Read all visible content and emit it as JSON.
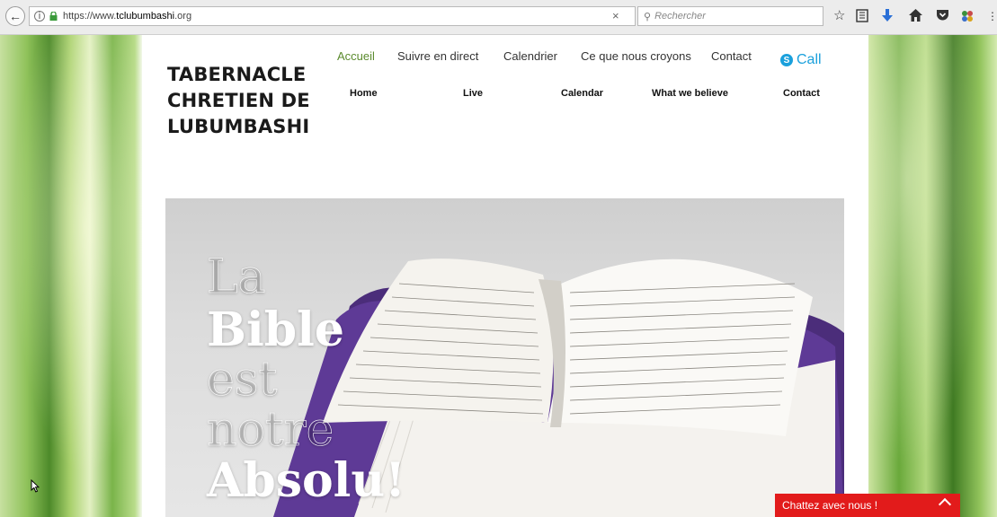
{
  "browser": {
    "url_prefix": "https://www.",
    "url_domain": "tclubumbashi",
    "url_suffix": ".org",
    "search_placeholder": "Rechercher",
    "clear_glyph": "×"
  },
  "site": {
    "logo_lines": [
      "TABERNACLE",
      "CHRETIEN DE",
      "LUBUMBASHI"
    ],
    "nav_fr": [
      "Accueil",
      "Suivre en direct",
      "Calendrier",
      "Ce que nous croyons",
      "Contact"
    ],
    "nav_en": [
      "Home",
      "Live",
      "Calendar",
      "What we believe",
      "Contact"
    ],
    "call_label": "Call",
    "accent_color": "#5b8b2e"
  },
  "hero": {
    "lines": [
      "La",
      "Bible",
      "est",
      "notre",
      "Absolu!"
    ]
  },
  "chat": {
    "label": "Chattez avec nous !",
    "color": "#e21b1b"
  },
  "icons": [
    "back-arrow-icon",
    "info-icon",
    "lock-icon",
    "search-icon",
    "bookmark-star-icon",
    "reading-list-icon",
    "download-icon",
    "home-icon",
    "pocket-icon",
    "extension-icon",
    "menu-icon",
    "skype-icon",
    "chevron-up-icon",
    "mouse-cursor-icon"
  ]
}
